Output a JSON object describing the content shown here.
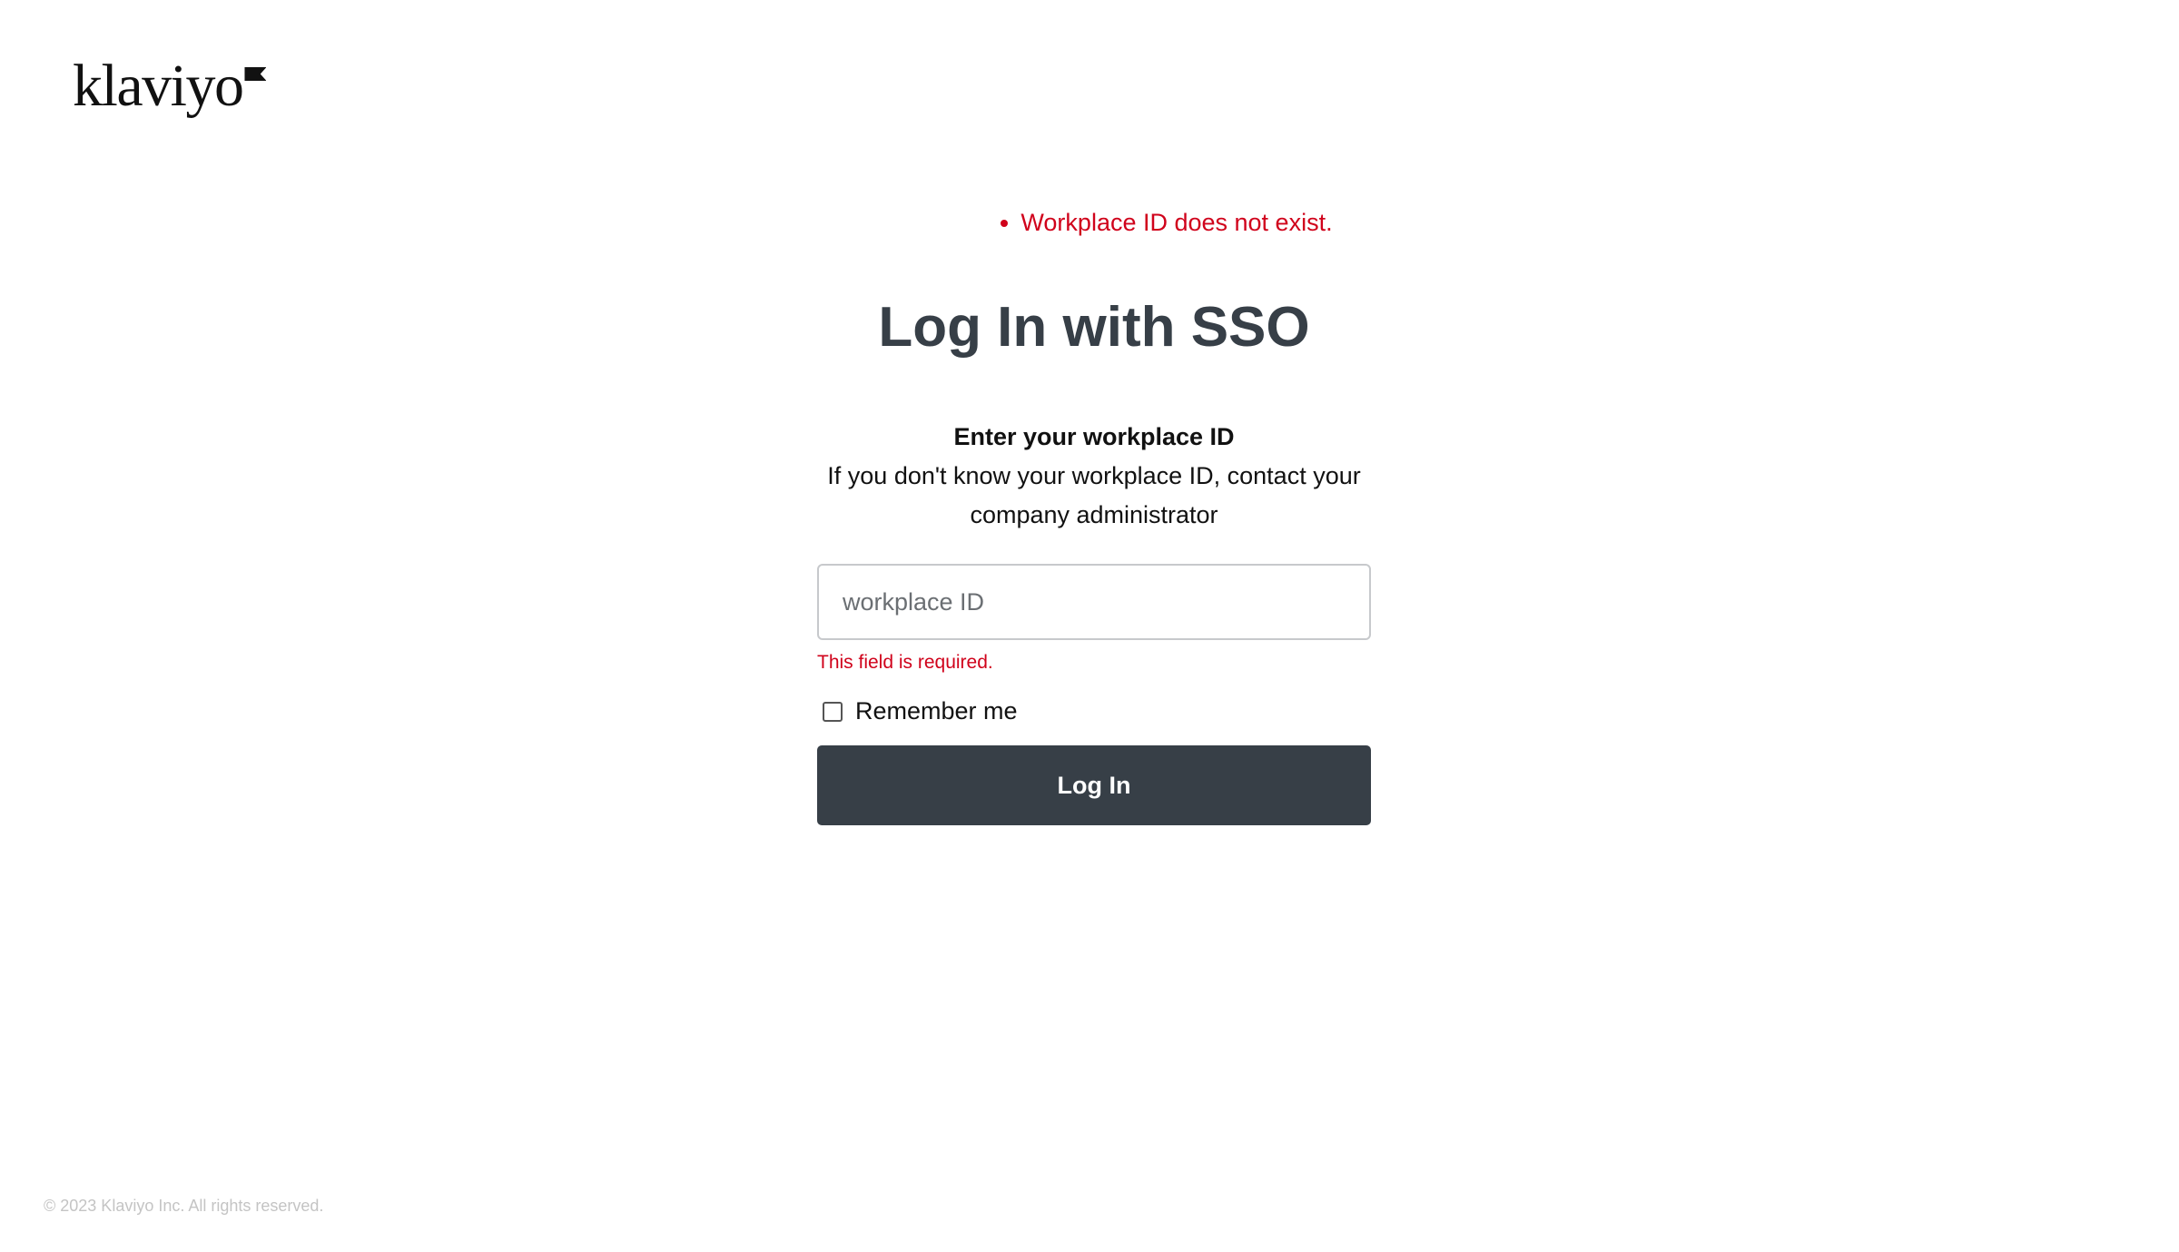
{
  "brand": {
    "logo_text": "klaviyo",
    "colors": {
      "error": "#d0021b",
      "heading": "#373f47",
      "button_bg": "#373f47",
      "button_text": "#ffffff"
    }
  },
  "alerts": {
    "errors": [
      "Workplace ID does not exist."
    ]
  },
  "form": {
    "title": "Log In with SSO",
    "instructions_heading": "Enter your workplace ID",
    "instructions_body": "If you don't know your workplace ID, contact your company administrator",
    "workplace_input": {
      "value": "",
      "placeholder": "workplace ID"
    },
    "field_error": "This field is required.",
    "remember_me": {
      "label": "Remember me",
      "checked": false
    },
    "submit_label": "Log In"
  },
  "footer": {
    "copyright": "© 2023 Klaviyo Inc. All rights reserved."
  }
}
